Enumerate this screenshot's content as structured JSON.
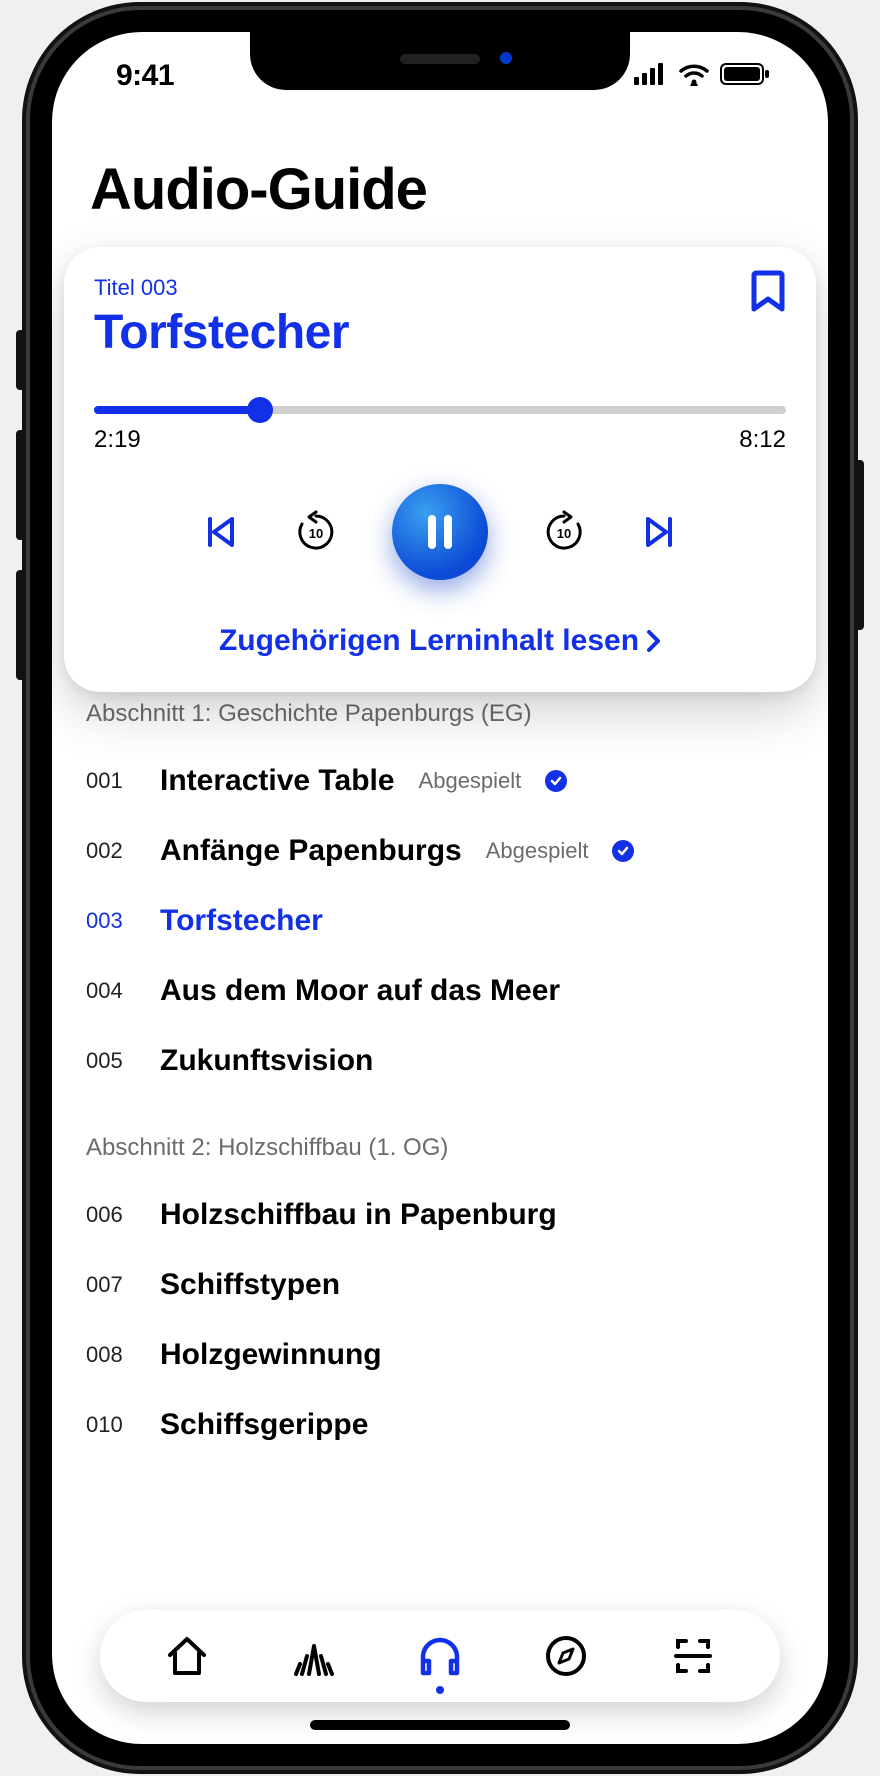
{
  "status": {
    "time": "9:41"
  },
  "page_title": "Audio-Guide",
  "player": {
    "track_label": "Titel 003",
    "track_title": "Torfstecher",
    "elapsed": "2:19",
    "total": "8:12",
    "progress_percent": 24,
    "related_link": "Zugehörigen Lerninhalt lesen"
  },
  "played_label": "Abgespielt",
  "sections": [
    {
      "header": "Abschnitt 1: Geschichte Papenburgs (EG)",
      "partial": true,
      "tracks": [
        {
          "num": "001",
          "name": "Interactive Table",
          "played": true
        },
        {
          "num": "002",
          "name": "Anfänge Papenburgs",
          "played": true
        },
        {
          "num": "003",
          "name": "Torfstecher",
          "active": true
        },
        {
          "num": "004",
          "name": "Aus dem Moor auf das Meer"
        },
        {
          "num": "005",
          "name": "Zukunftsvision"
        }
      ]
    },
    {
      "header": "Abschnitt 2: Holzschiffbau (1. OG)",
      "tracks": [
        {
          "num": "006",
          "name": "Holzschiffbau in Papenburg"
        },
        {
          "num": "007",
          "name": "Schiffstypen"
        },
        {
          "num": "008",
          "name": "Holzgewinnung"
        },
        {
          "num": "010",
          "name": "Schiffsgerippe"
        }
      ]
    }
  ]
}
